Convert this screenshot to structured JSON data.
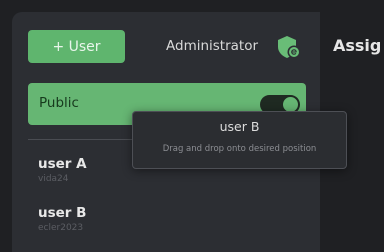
{
  "main": {
    "title": "Assig"
  },
  "sidebar": {
    "add_user_label": "+ User",
    "account_label": "Administrator",
    "account_icon": "admin-shield-icon",
    "group": {
      "label": "Public",
      "toggle_on": true
    },
    "users": [
      {
        "name": "user A",
        "password": "vida24"
      },
      {
        "name": "user B",
        "password": "ecler2023"
      }
    ]
  },
  "drag_tooltip": {
    "title": "user B",
    "hint": "Drag and drop onto desired position"
  },
  "colors": {
    "accent": "#5fb56e",
    "panel": "#2c2e33",
    "background": "#1f2023"
  }
}
